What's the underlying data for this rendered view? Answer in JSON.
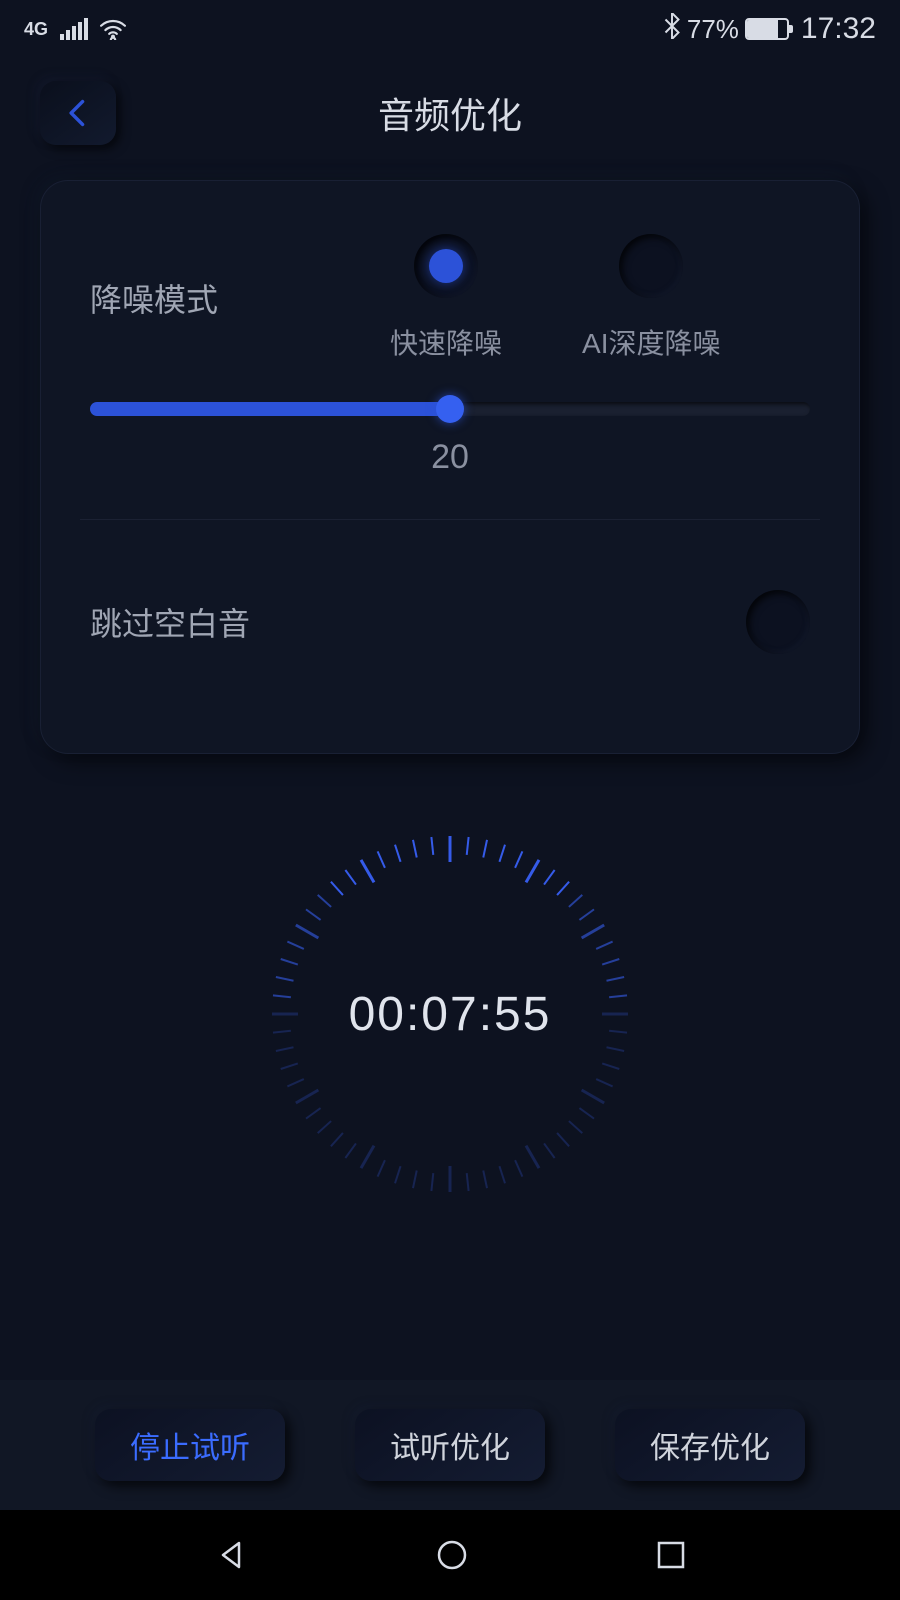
{
  "status": {
    "network": "4G",
    "battery_pct": "77%",
    "time": "17:32"
  },
  "header": {
    "title": "音频优化"
  },
  "noise": {
    "label": "降噪模式",
    "options": [
      {
        "label": "快速降噪",
        "selected": true
      },
      {
        "label": "AI深度降噪",
        "selected": false
      }
    ],
    "slider_value": "20",
    "slider_pct": 50
  },
  "skip_blank": {
    "label": "跳过空白音",
    "enabled": false
  },
  "timer": {
    "display": "00:07:55"
  },
  "actions": {
    "stop": "停止试听",
    "preview": "试听优化",
    "save": "保存优化"
  }
}
